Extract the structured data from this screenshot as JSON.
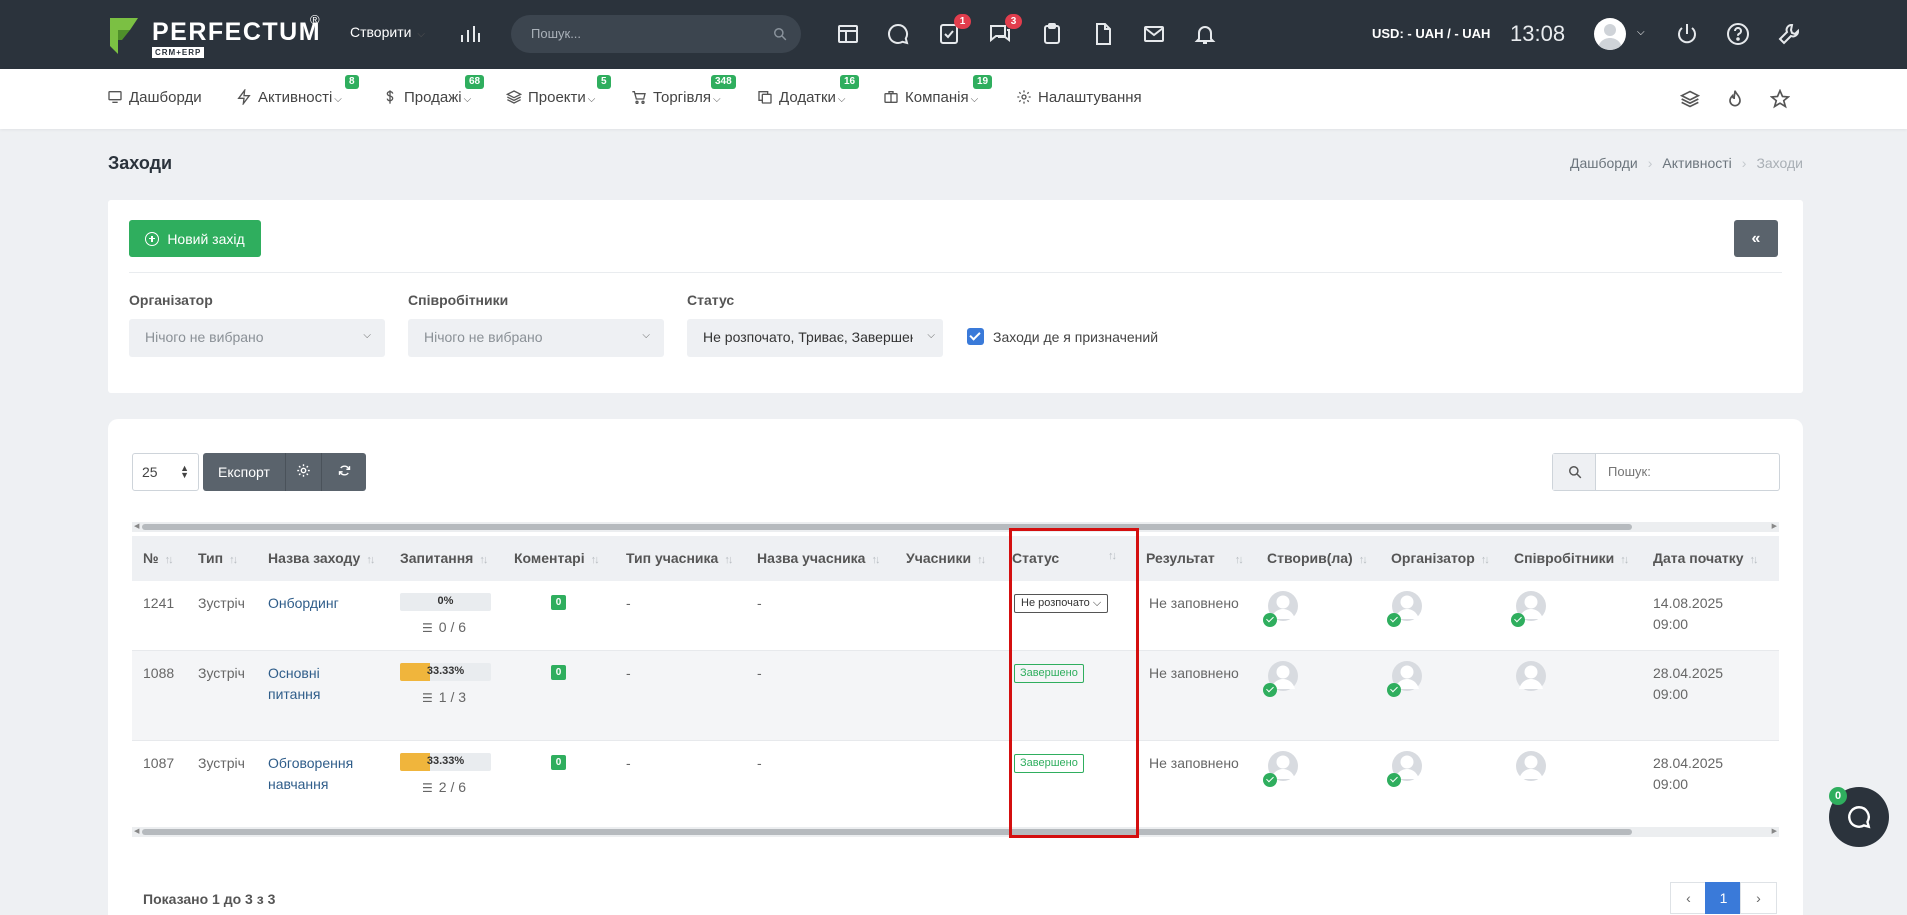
{
  "topbar": {
    "logo_text": "PERFECTUM",
    "logo_reg": "®",
    "logo_sub": "CRM+ERP",
    "create_label": "Створити",
    "search_placeholder": "Пошук...",
    "tasks_badge": "1",
    "messages_badge": "3",
    "currency": "USD: - UAH / - UAH",
    "time": "13:08"
  },
  "nav": {
    "items": [
      {
        "label": "Дашборди",
        "badge": ""
      },
      {
        "label": "Активності",
        "badge": "8"
      },
      {
        "label": "Продажі",
        "badge": "68"
      },
      {
        "label": "Проекти",
        "badge": "5"
      },
      {
        "label": "Торгівля",
        "badge": "348"
      },
      {
        "label": "Додатки",
        "badge": "16"
      },
      {
        "label": "Компанія",
        "badge": "19"
      },
      {
        "label": "Налаштування",
        "badge": ""
      }
    ]
  },
  "page": {
    "title": "Заходи",
    "breadcrumb": [
      "Дашборди",
      "Активності",
      "Заходи"
    ]
  },
  "filters": {
    "new_button": "Новий захід",
    "collapse": "«",
    "organizer_label": "Організатор",
    "organizer_value": "Нічого не вибрано",
    "employees_label": "Співробітники",
    "employees_value": "Нічого не вибрано",
    "status_label": "Статус",
    "status_value": "Не розпочато, Триває, Завершено",
    "assigned_label": "Заходи де я призначений"
  },
  "toolbar": {
    "page_size": "25",
    "export_label": "Експорт",
    "search_placeholder": "Пошук:"
  },
  "table": {
    "columns": [
      "№",
      "Тип",
      "Назва заходу",
      "Запитання",
      "Коментарі",
      "Тип учасника",
      "Назва учасника",
      "Учасники",
      "Статус",
      "Результат",
      "Створив(ла)",
      "Організатор",
      "Співробітники",
      "Дата початку"
    ],
    "rows": [
      {
        "id": "1241",
        "type": "Зустріч",
        "name1": "Онбординг",
        "name2": "",
        "progress_pct": 0,
        "progress_label": "0%",
        "questions": "0 / 6",
        "comments": "0",
        "participant_type": "-",
        "participant_name": "-",
        "status": "Не розпочато",
        "status_kind": "select",
        "result": "Не заповнено",
        "date": "14.08.2025",
        "time": "09:00",
        "emp_check": true
      },
      {
        "id": "1088",
        "type": "Зустріч",
        "name1": "Основні",
        "name2": "питання",
        "progress_pct": 33.33,
        "progress_label": "33.33%",
        "questions": "1 / 3",
        "comments": "0",
        "participant_type": "-",
        "participant_name": "-",
        "status": "Завершено",
        "status_kind": "done",
        "result": "Не заповнено",
        "date": "28.04.2025",
        "time": "09:00",
        "emp_check": false
      },
      {
        "id": "1087",
        "type": "Зустріч",
        "name1": "Обговорення",
        "name2": "навчання",
        "progress_pct": 33.33,
        "progress_label": "33.33%",
        "questions": "2 / 6",
        "comments": "0",
        "participant_type": "-",
        "participant_name": "-",
        "status": "Завершено",
        "status_kind": "done",
        "result": "Не заповнено",
        "date": "28.04.2025",
        "time": "09:00",
        "emp_check": false
      }
    ]
  },
  "footer": {
    "info": "Показано 1 до 3 з 3",
    "prev": "‹",
    "page": "1",
    "next": "›"
  },
  "chat": {
    "badge": "0"
  },
  "colors": {
    "topbar": "#2b333c",
    "accent_green": "#2fae5e",
    "highlight_red": "#d40f0f",
    "progress": "#f0b53c"
  }
}
